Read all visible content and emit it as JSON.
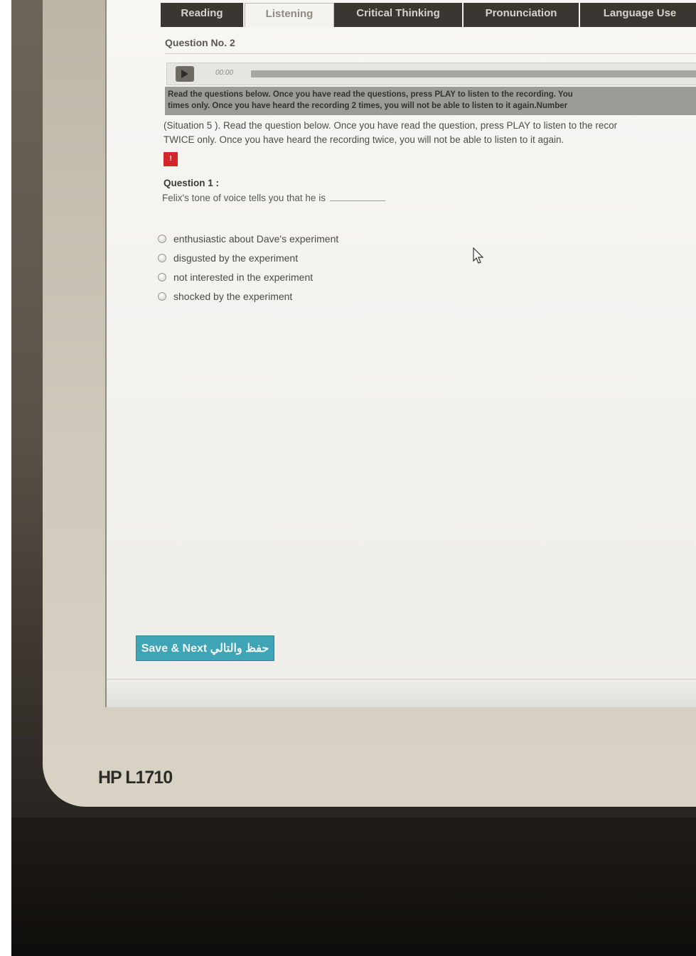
{
  "tabs": [
    {
      "label": "Reading",
      "active": false
    },
    {
      "label": "Listening",
      "active": true
    },
    {
      "label": "Critical Thinking",
      "active": false
    },
    {
      "label": "Pronunciation",
      "active": false
    },
    {
      "label": "Language Use",
      "active": false
    }
  ],
  "question_header": "Question No. 2",
  "player": {
    "time": "00:00",
    "progress_fraction": 0.0,
    "play_icon": "play-icon"
  },
  "instructions": {
    "line1": "Read the questions below. Once you have read the questions, press PLAY to listen to the recording. You",
    "line2": "times only. Once you have heard the recording 2 times, you will not be able to listen to it again.Number"
  },
  "situation": {
    "line1": "(Situation 5 ). Read the question below. Once you have read the question, press PLAY to listen to the recor",
    "line2": "TWICE only. Once you have heard the recording twice, you will not be able to listen to it again."
  },
  "flag_label": "!",
  "question": {
    "label": "Question 1 :",
    "text": "Felix's tone of voice tells you that he is",
    "options": [
      "enthusiastic about Dave's experiment",
      "disgusted by the experiment",
      "not interested in the experiment",
      "shocked by the experiment"
    ]
  },
  "save_button_label": "Save & Next حفظ والتالي",
  "monitor_brand": "HP L1710",
  "colors": {
    "tab_bg": "#3a3632",
    "save_button": "#3fa4b5",
    "flag": "#d3262b",
    "banner": "#9d9b97"
  }
}
